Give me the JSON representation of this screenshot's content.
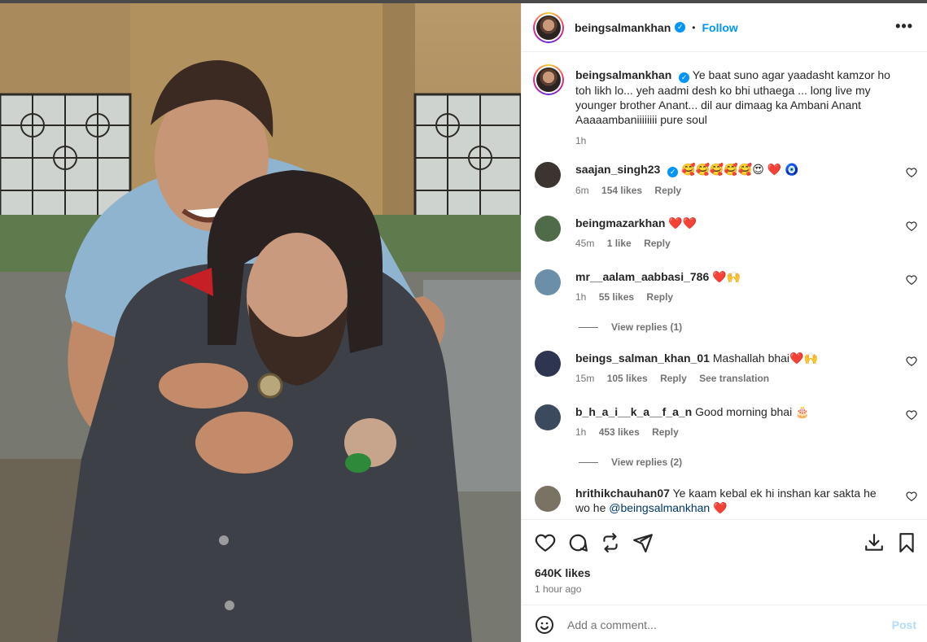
{
  "post": {
    "author": "beingsalmankhan",
    "follow_label": "Follow",
    "dot": "•",
    "more_label": "•••",
    "caption": "Ye baat suno agar yaadasht kamzor ho toh likh lo... yeh aadmi desh ko bhi uthaega ... long live my younger brother Anant... dil aur dimaag ka Ambani Anant Aaaaambaniiiiiiii pure soul",
    "caption_age": "1h",
    "likes": "640K likes",
    "posted": "1 hour ago"
  },
  "comments": [
    {
      "user": "saajan_singh23",
      "verified": true,
      "text": "🥰🥰🥰🥰🥰😍 ❤️ 🧿",
      "age": "6m",
      "likes": "154 likes",
      "reply": "Reply",
      "avatar_color": "#3b3430"
    },
    {
      "user": "beingmazarkhan",
      "verified": false,
      "text": "❤️❤️",
      "age": "45m",
      "likes": "1 like",
      "reply": "Reply",
      "avatar_color": "#4f6b48"
    },
    {
      "user": "mr__aalam_aabbasi_786",
      "verified": false,
      "text": "❤️🙌",
      "age": "1h",
      "likes": "55 likes",
      "reply": "Reply",
      "avatar_color": "#6b8fa8",
      "view_replies": "View replies (1)"
    },
    {
      "user": "beings_salman_khan_01",
      "verified": false,
      "text": "Mashallah bhai❤️🙌",
      "age": "15m",
      "likes": "105 likes",
      "reply": "Reply",
      "extra": "See translation",
      "avatar_color": "#2e3550"
    },
    {
      "user": "b_h_a_i__k_a__f_a_n",
      "verified": false,
      "text": "Good morning bhai 🎂",
      "age": "1h",
      "likes": "453 likes",
      "reply": "Reply",
      "avatar_color": "#3c4a5e",
      "view_replies": "View replies (2)"
    },
    {
      "user": "hrithikchauhan07",
      "verified": false,
      "text": "Ye kaam kebal ek hi inshan kar sakta he wo he",
      "mention": "@beingsalmankhan",
      "trail": "❤️",
      "avatar_color": "#7a7263"
    }
  ],
  "add_comment": {
    "placeholder": "Add a comment...",
    "post_label": "Post"
  },
  "icons": [
    "heart-icon",
    "comment-icon",
    "share-icon",
    "send-icon",
    "download-icon",
    "bookmark-icon",
    "emoji-icon",
    "more-icon"
  ],
  "colors": {
    "accent": "#0095f6",
    "text": "#262626",
    "muted": "#737373",
    "post_disabled": "#b3dbff"
  }
}
